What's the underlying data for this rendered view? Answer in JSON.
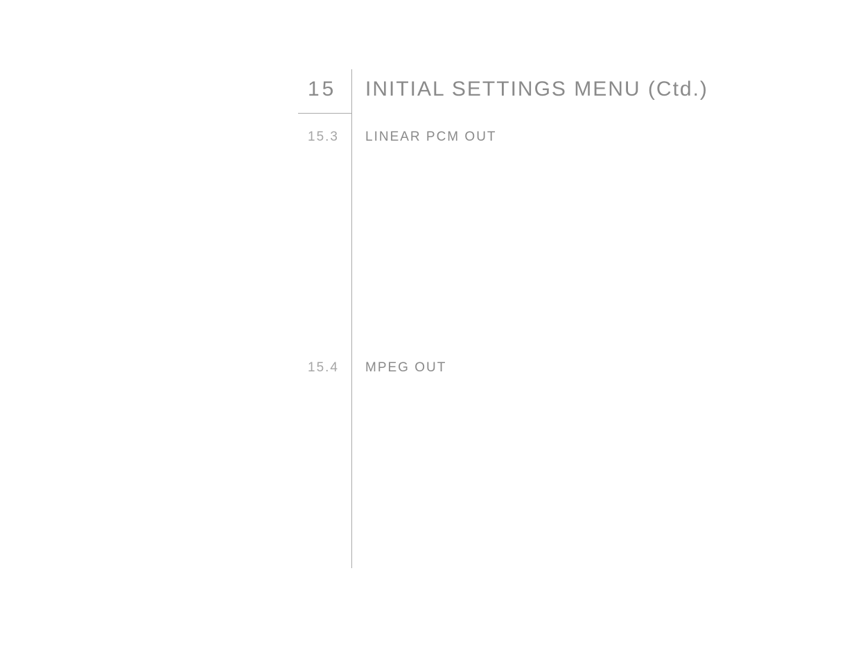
{
  "chapter": {
    "number": "15",
    "title": "INITIAL SETTINGS MENU (Ctd.)"
  },
  "sections": [
    {
      "number": "15.3",
      "title": "LINEAR PCM OUT"
    },
    {
      "number": "15.4",
      "title": "MPEG OUT"
    }
  ]
}
